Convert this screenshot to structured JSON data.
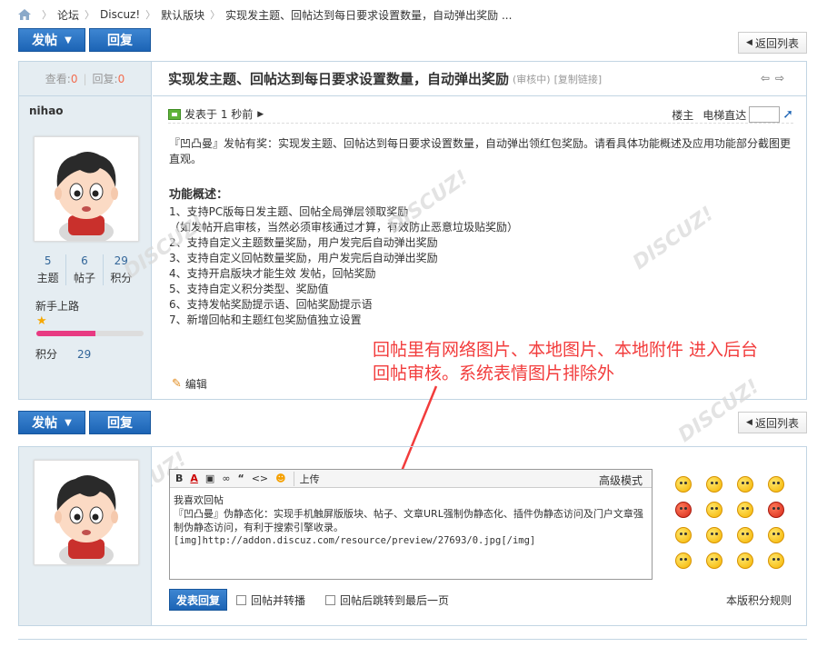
{
  "breadcrumb": {
    "items": [
      "论坛",
      "Discuz!",
      "默认版块",
      "实现发主题、回帖达到每日要求设置数量，自动弹出奖励 ..."
    ]
  },
  "buttons": {
    "post": "发帖",
    "reply": "回复",
    "return_list": "返回列表"
  },
  "thread": {
    "views_label": "查看:",
    "views": "0",
    "replies_label": "回复:",
    "replies": "0",
    "title": "实现发主题、回帖达到每日要求设置数量，自动弹出奖励",
    "status": "(审核中)",
    "copy_link": "[复制链接]"
  },
  "author": {
    "name": "nihao",
    "topics": "5",
    "topics_label": "主题",
    "posts": "6",
    "posts_label": "帖子",
    "credits_value": "29",
    "credits_label": "积分",
    "level": "新手上路",
    "credit_label": "积分",
    "credit": "29",
    "progress": 0.55
  },
  "post": {
    "posted_time": "发表于 1 秒前",
    "owner": "楼主",
    "jump_label": "电梯直达",
    "intro": "『凹凸曼』发帖有奖：实现发主题、回帖达到每日要求设置数量，自动弹出领红包奖励。请看具体功能概述及应用功能部分截图更直观。",
    "feature_title": "功能概述：",
    "features": [
      "1、支持PC版每日发主题、回帖全局弹层领取奖励",
      "（如发帖开启审核，当然必须审核通过才算，有效防止恶意垃圾贴奖励）",
      "2、支持自定义主题数量奖励，用户发完后自动弹出奖励",
      "3、支持自定义回帖数量奖励，用户发完后自动弹出奖励",
      "4、支持开启版块才能生效 发帖，回帖奖励",
      "5、支持自定义积分类型、奖励值",
      "6、支持发帖奖励提示语、回帖奖励提示语",
      "7、新增回帖和主题红包奖励值独立设置"
    ],
    "edit": "编辑"
  },
  "annotation": {
    "line1": "回帖里有网络图片、本地图片、本地附件 进入后台",
    "line2": "回帖审核。系统表情图片排除外"
  },
  "editor": {
    "advanced": "高级模式",
    "upload": "上传",
    "line1": "我喜欢回帖",
    "line2": "『凹凸曼』伪静态化：实现手机触屏版版块、帖子、文章URL强制伪静态化、插件伪静态访问及门户文章强制伪静态访问，有利于搜索引擎收录。",
    "line3": "[img]http://addon.discuz.com/resource/preview/27693/0.jpg[/img]"
  },
  "reply_form": {
    "submit": "发表回复",
    "opt1": "回帖并转播",
    "opt2": "回帖后跳转到最后一页",
    "rules": "本版积分规则"
  },
  "colors": {
    "accent_blue": "#1c64b5",
    "annotation_red": "#f23c3c",
    "sidebar_bg": "#e5edf2"
  }
}
